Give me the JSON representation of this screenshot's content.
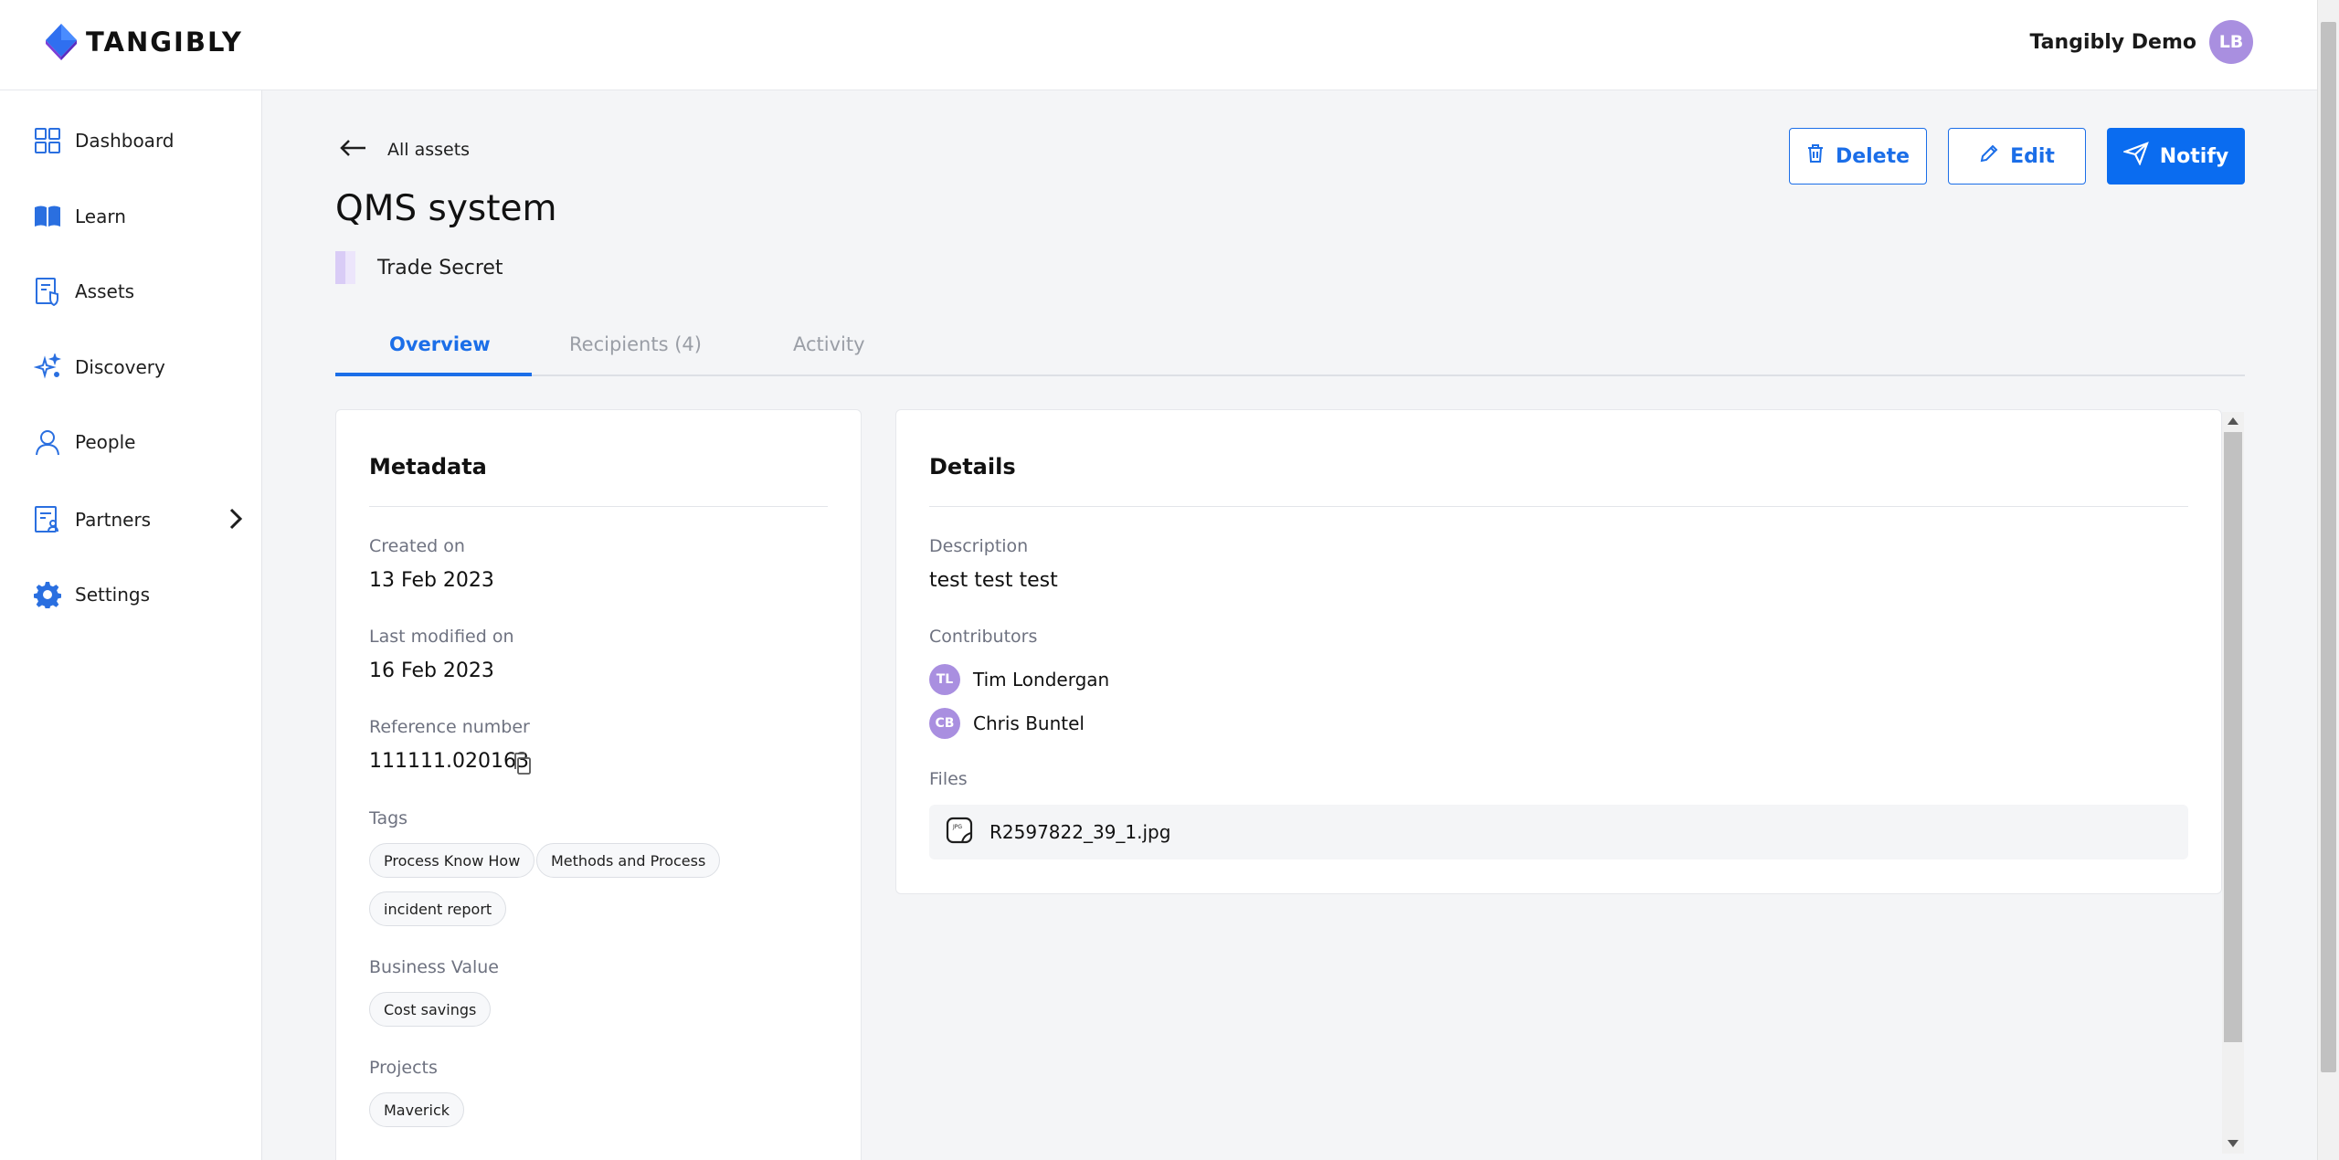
{
  "brand": {
    "name": "TANGIBLY"
  },
  "header": {
    "org_name": "Tangibly Demo",
    "avatar_initials": "LB"
  },
  "sidebar": {
    "items": [
      {
        "label": "Dashboard",
        "icon": "dashboard-grid-icon"
      },
      {
        "label": "Learn",
        "icon": "book-icon"
      },
      {
        "label": "Assets",
        "icon": "asset-document-shield-icon"
      },
      {
        "label": "Discovery",
        "icon": "sparkle-icon"
      },
      {
        "label": "People",
        "icon": "person-icon"
      },
      {
        "label": "Partners",
        "icon": "partner-document-icon"
      },
      {
        "label": "Settings",
        "icon": "gear-icon"
      }
    ]
  },
  "back": {
    "label": "All assets"
  },
  "asset": {
    "title": "QMS system",
    "type": "Trade Secret"
  },
  "actions": {
    "delete": "Delete",
    "edit": "Edit",
    "notify": "Notify"
  },
  "tabs": [
    {
      "label": "Overview"
    },
    {
      "label": "Recipients (4)"
    },
    {
      "label": "Activity"
    }
  ],
  "metadata": {
    "title": "Metadata",
    "created_label": "Created on",
    "created_value": "13 Feb 2023",
    "modified_label": "Last modified on",
    "modified_value": "16 Feb 2023",
    "reference_label": "Reference number",
    "reference_value": "111111.020163",
    "tags_label": "Tags",
    "tags": [
      "Process Know How",
      "Methods and Process",
      "incident report"
    ],
    "business_value_label": "Business Value",
    "business_values": [
      "Cost savings"
    ],
    "projects_label": "Projects",
    "projects": [
      "Maverick"
    ]
  },
  "details": {
    "title": "Details",
    "description_label": "Description",
    "description_value": "test test test",
    "contributors_label": "Contributors",
    "contributors": [
      {
        "initials": "TL",
        "name": "Tim Londergan"
      },
      {
        "initials": "CB",
        "name": "Chris Buntel"
      }
    ],
    "files_label": "Files",
    "files": [
      {
        "name": "R2597822_39_1.jpg",
        "icon": "jpg-file-icon"
      }
    ]
  },
  "colors": {
    "accent": "#1b6ee8",
    "primary_button": "#0a6cf0",
    "avatar": "#a98fe0",
    "trade_secret_swatch": "#d9ccf6"
  }
}
